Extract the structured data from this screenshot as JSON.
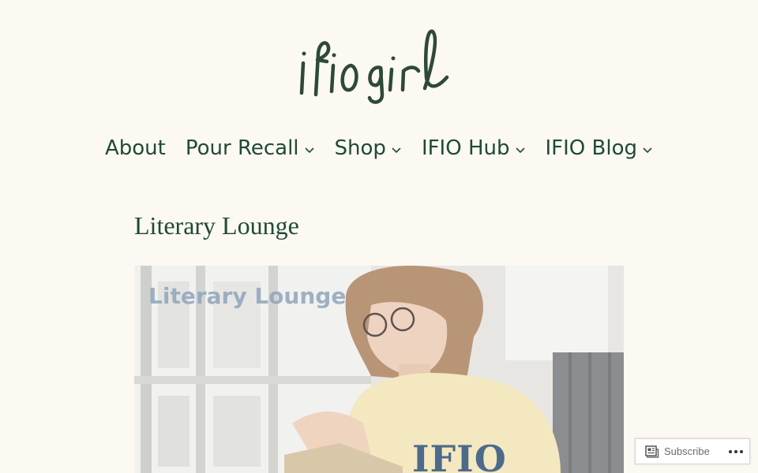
{
  "site": {
    "logo_text": "ifio girl"
  },
  "nav": {
    "items": [
      {
        "label": "About",
        "has_dropdown": false
      },
      {
        "label": "Pour Recall",
        "has_dropdown": true
      },
      {
        "label": "Shop",
        "has_dropdown": true
      },
      {
        "label": "IFIO Hub",
        "has_dropdown": true
      },
      {
        "label": "IFIO Blog",
        "has_dropdown": true
      }
    ]
  },
  "page": {
    "title": "Literary Lounge"
  },
  "hero": {
    "caption": "Literary Lounge",
    "shirt_text": "IFIO"
  },
  "subscribe_bar": {
    "subscribe_label": "Subscribe",
    "subscribe_icon": "reader-icon",
    "more_icon": "ellipsis-icon"
  },
  "colors": {
    "background": "#fcf9f3",
    "brand_green": "#1f4a35",
    "caption_blue": "#8fa5bc"
  }
}
